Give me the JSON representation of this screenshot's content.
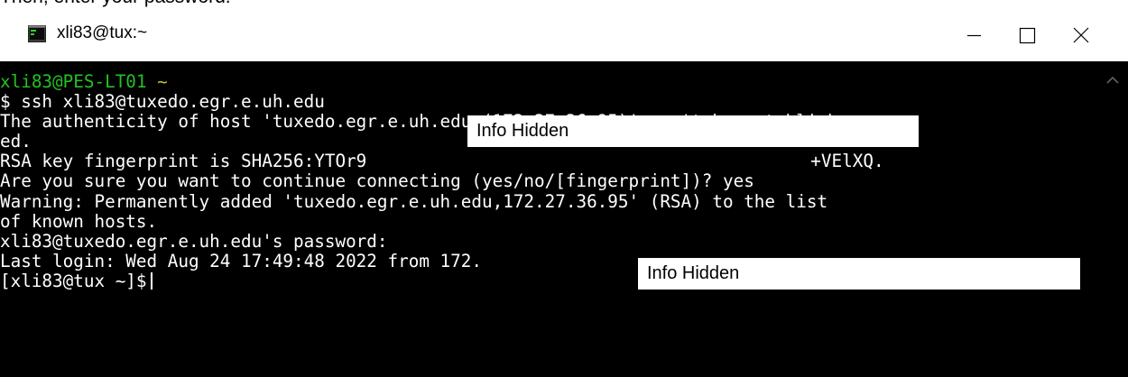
{
  "document": {
    "caption": "Then, enter your password."
  },
  "window": {
    "title": "xli83@tux:~",
    "icon": "terminal-app-icon",
    "controls": [
      "minimize-icon",
      "maximize-icon",
      "close-icon"
    ]
  },
  "terminal": {
    "colors": {
      "background": "#000000",
      "text": "#ffffff",
      "user": "#23c123",
      "tilde": "#c1c123"
    },
    "prompt_user": "xli83@PES-LT01",
    "prompt_tilde": "~",
    "lines": [
      "$ ssh xli83@tuxedo.egr.e.uh.edu",
      "The authenticity of host 'tuxedo.egr.e.uh.edu (172.27.36.95)' can't be establish",
      "ed.",
      "RSA key fingerprint is SHA256:YTOr9",
      "Are you sure you want to continue connecting (yes/no/[fingerprint])? yes",
      "Warning: Permanently added 'tuxedo.egr.e.uh.edu,172.27.36.95' (RSA) to the list",
      "of known hosts.",
      "xli83@tuxedo.egr.e.uh.edu's password:",
      "Last login: Wed Aug 24 17:49:48 2022 from 172.",
      "[xli83@tux ~]$"
    ],
    "fingerprint_tail": "+VElXQ.",
    "redactions": [
      "Info Hidden",
      "Info Hidden"
    ]
  }
}
